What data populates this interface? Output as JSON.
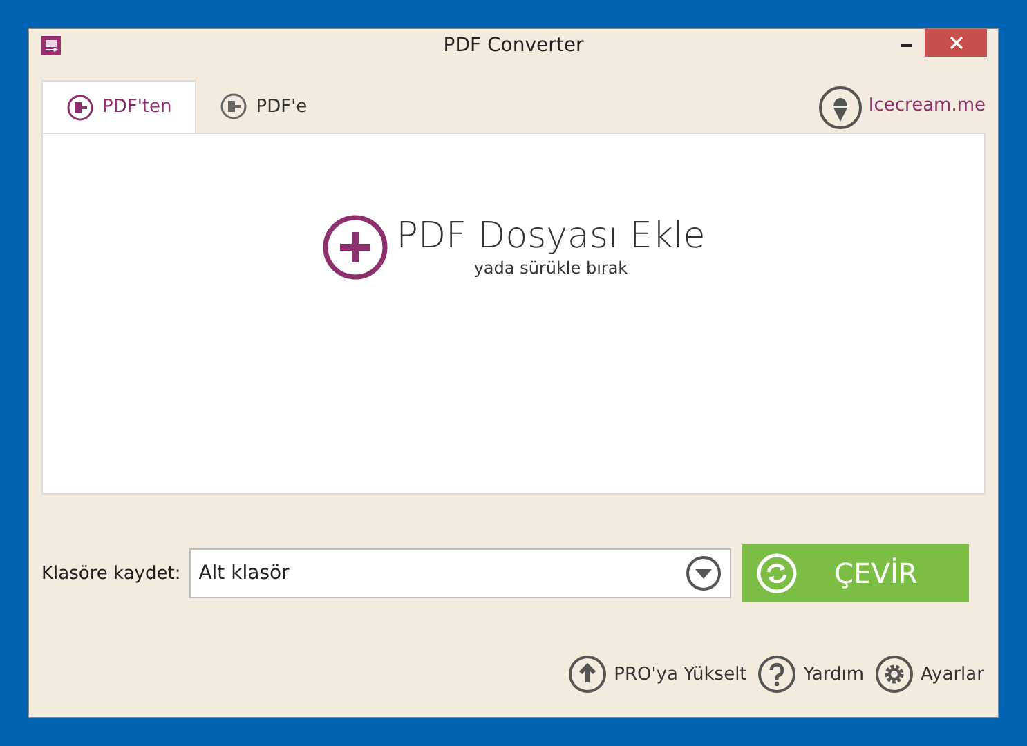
{
  "window": {
    "title": "PDF Converter"
  },
  "tabs": [
    {
      "label": "PDF'ten",
      "selected": true
    },
    {
      "label": "PDF'e",
      "selected": false
    }
  ],
  "brand_link": "Icecream.me",
  "drop_area": {
    "title": "PDF Dosyası Ekle",
    "subtitle": "yada sürükle bırak"
  },
  "save_folder": {
    "label": "Klasöre kaydet:",
    "value": "Alt klasör"
  },
  "convert_button": "ÇEVİR",
  "footer_buttons": [
    {
      "kind": "upgrade",
      "label": "PRO'ya Yükselt"
    },
    {
      "kind": "help",
      "label": "Yardım"
    },
    {
      "kind": "settings",
      "label": "Ayarlar"
    }
  ]
}
